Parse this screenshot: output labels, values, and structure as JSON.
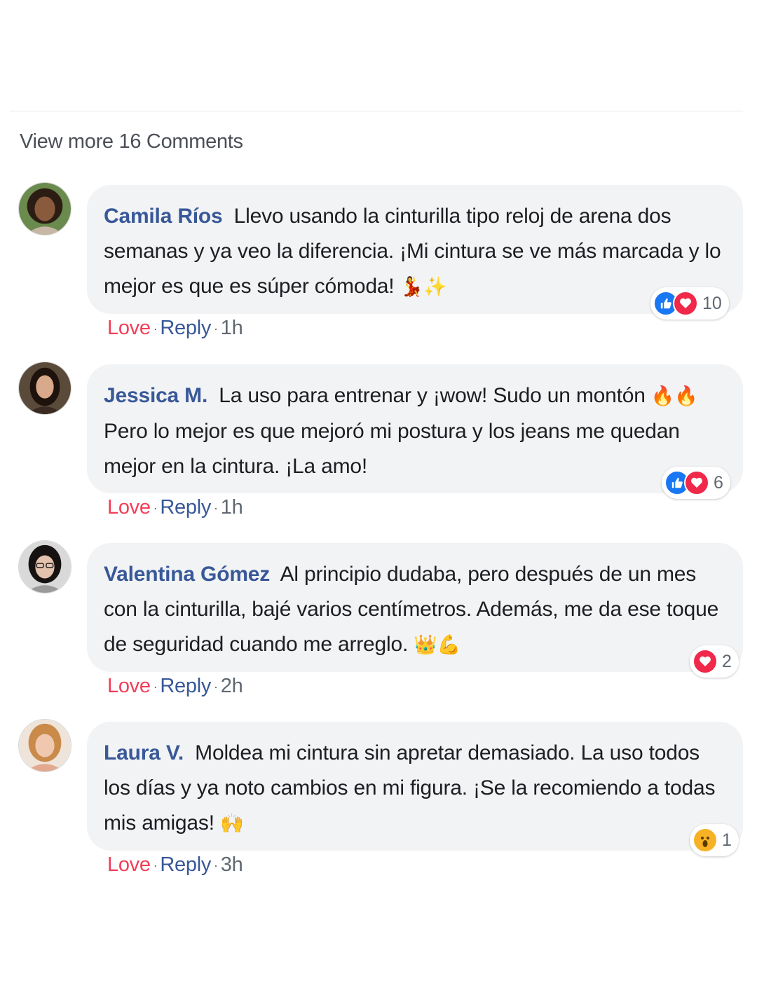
{
  "view_more_label": "View more 16 Comments",
  "comments": [
    {
      "author": "Camila Ríos",
      "text": "Llevo usando la cinturilla tipo reloj de arena dos semanas y ya veo la diferencia. ¡Mi cintura se ve más marcada y lo mejor es que es súper cómoda!",
      "emoji": "💃✨",
      "reactions": [
        "like",
        "love"
      ],
      "reaction_count": "10",
      "love_label": "Love",
      "reply_label": "Reply",
      "time": "1h"
    },
    {
      "author": "Jessica M.",
      "text_before": "La uso para entrenar y ¡wow! Sudo un montón",
      "emoji": "🔥🔥",
      "text": "Pero lo mejor es que mejoró mi postura y los jeans me quedan mejor en la cintura. ¡La amo!",
      "reactions": [
        "like",
        "love"
      ],
      "reaction_count": "6",
      "love_label": "Love",
      "reply_label": "Reply",
      "time": "1h"
    },
    {
      "author": "Valentina Gómez",
      "text": "Al principio dudaba, pero después de un mes con la cinturilla, bajé varios centímetros. Además, me da ese toque de seguridad cuando me arreglo.",
      "emoji": "👑💪",
      "reactions": [
        "love"
      ],
      "reaction_count": "2",
      "love_label": "Love",
      "reply_label": "Reply",
      "time": "2h"
    },
    {
      "author": "Laura V.",
      "text": "Moldea mi cintura sin apretar demasiado. La uso todos los días y ya noto cambios en mi figura. ¡Se la recomiendo a todas mis amigas!",
      "emoji": "🙌",
      "reactions": [
        "wow"
      ],
      "reaction_count": "1",
      "love_label": "Love",
      "reply_label": "Reply",
      "time": "3h"
    }
  ],
  "colors": {
    "author": "#385898",
    "love_action": "#f33e58",
    "bubble": "#f2f3f5",
    "like": "#1877f2",
    "love": "#f0284a",
    "wow": "#f7b125"
  },
  "icons": [
    "avatar",
    "like-reaction-icon",
    "love-reaction-icon",
    "wow-reaction-icon"
  ]
}
